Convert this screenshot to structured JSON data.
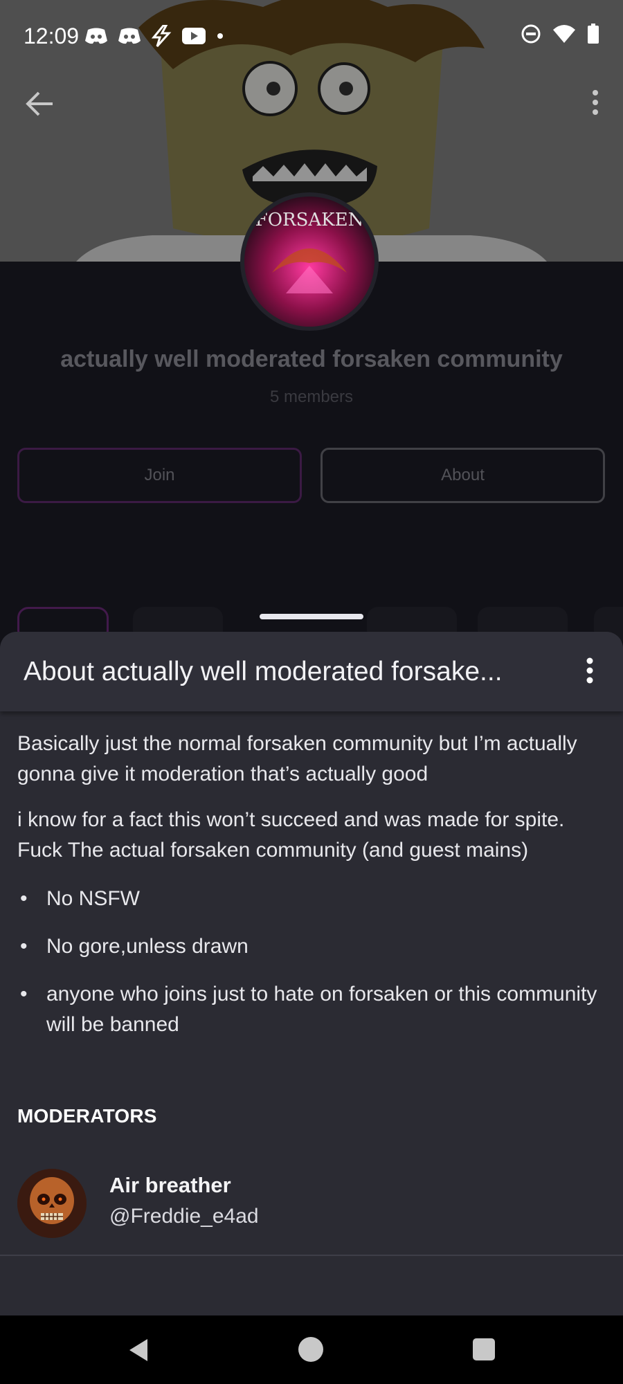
{
  "status_bar": {
    "time": "12:09",
    "left_icons": [
      "discord-icon",
      "discord-icon",
      "lightning-icon",
      "youtube-icon",
      "notification-dot-icon"
    ],
    "right_icons": [
      "do-not-disturb-icon",
      "wifi-icon",
      "battery-icon"
    ]
  },
  "top_nav": {
    "back_icon": "arrow-left-icon",
    "more_icon": "more-vertical-icon"
  },
  "community": {
    "avatar_text": "FORSAKEN",
    "title": "actually well moderated forsaken community",
    "members": "5 members",
    "join_label": "Join",
    "about_label": "About"
  },
  "sheet": {
    "title": "About actually well moderated forsake...",
    "paragraphs": [
      "Basically just the normal forsaken community but I’m actually gonna give it moderation that’s actually good",
      "i know for a fact this won’t succeed and was made for spite. Fuck The actual forsaken community (and guest mains)"
    ],
    "rules": [
      "No NSFW",
      "No gore,unless drawn",
      "anyone who joins just to hate on forsaken or this community will be banned"
    ],
    "moderators_heading": "MODERATORS",
    "moderators": [
      {
        "name": "Air breather",
        "handle": "@Freddie_e4ad"
      }
    ]
  },
  "colors": {
    "sheet_bg": "#2b2b33",
    "join_border": "#5f2a6e",
    "text_primary": "#f2f2f5"
  }
}
